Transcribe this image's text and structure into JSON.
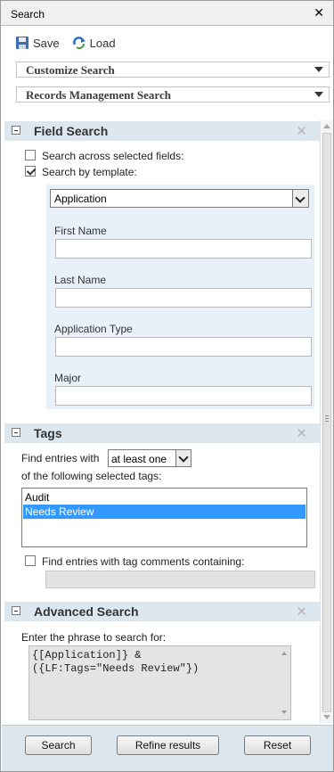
{
  "window": {
    "title": "Search"
  },
  "toolbar": {
    "save_label": "Save",
    "load_label": "Load"
  },
  "dropdowns": [
    {
      "label": "Customize Search"
    },
    {
      "label": "Records Management Search"
    }
  ],
  "field_search": {
    "title": "Field Search",
    "option_selected_fields": "Search across selected fields:",
    "option_template": "Search by template:",
    "template_checked": true,
    "template_value": "Application",
    "fields": [
      {
        "label": "First Name",
        "value": ""
      },
      {
        "label": "Last Name",
        "value": ""
      },
      {
        "label": "Application Type",
        "value": ""
      },
      {
        "label": "Major",
        "value": ""
      }
    ]
  },
  "tags": {
    "title": "Tags",
    "find_entries_with": "Find entries with",
    "match_mode": "at least one",
    "following_text": "of the following selected tags:",
    "list": [
      {
        "label": "Audit",
        "selected": false
      },
      {
        "label": "Needs Review",
        "selected": true
      }
    ],
    "comments_label": "Find entries with tag comments containing:",
    "comments_value": ""
  },
  "advanced": {
    "title": "Advanced Search",
    "prompt": "Enter the phrase to search for:",
    "phrase_line1": "{[Application]} &",
    "phrase_line2": "({LF:Tags=\"Needs Review\"})"
  },
  "footer": {
    "search_label": "Search",
    "refine_label": "Refine results",
    "reset_label": "Reset"
  }
}
